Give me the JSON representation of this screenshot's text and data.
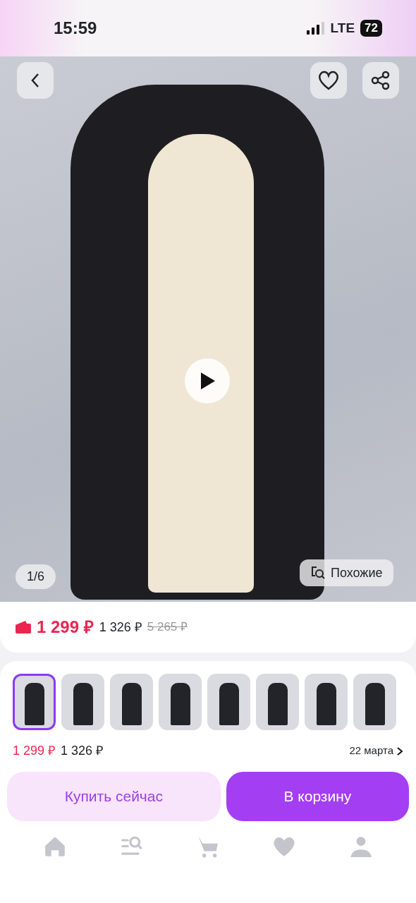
{
  "status_bar": {
    "time": "15:59",
    "network": "LTE",
    "battery": "72"
  },
  "gallery": {
    "counter": "1/6",
    "similar_label": "Похожие"
  },
  "price": {
    "current": "1 299 ₽",
    "old": "1 326 ₽",
    "original": "5 265 ₽"
  },
  "variants": [
    {
      "selected": true
    },
    {
      "selected": false
    },
    {
      "selected": false
    },
    {
      "selected": false
    },
    {
      "selected": false
    },
    {
      "selected": false
    },
    {
      "selected": false
    },
    {
      "selected": false
    }
  ],
  "purchase": {
    "price": "1 299 ₽",
    "old_price": "1 326 ₽",
    "delivery": "22 марта",
    "buttons": [
      {
        "kind": "secondary",
        "label": "Купить сейчас"
      },
      {
        "kind": "primary",
        "label": "В корзину"
      }
    ]
  },
  "nav_items": [
    {
      "kind": "home"
    },
    {
      "kind": "catalog"
    },
    {
      "kind": "cart"
    },
    {
      "kind": "favorites"
    },
    {
      "kind": "profile"
    }
  ]
}
